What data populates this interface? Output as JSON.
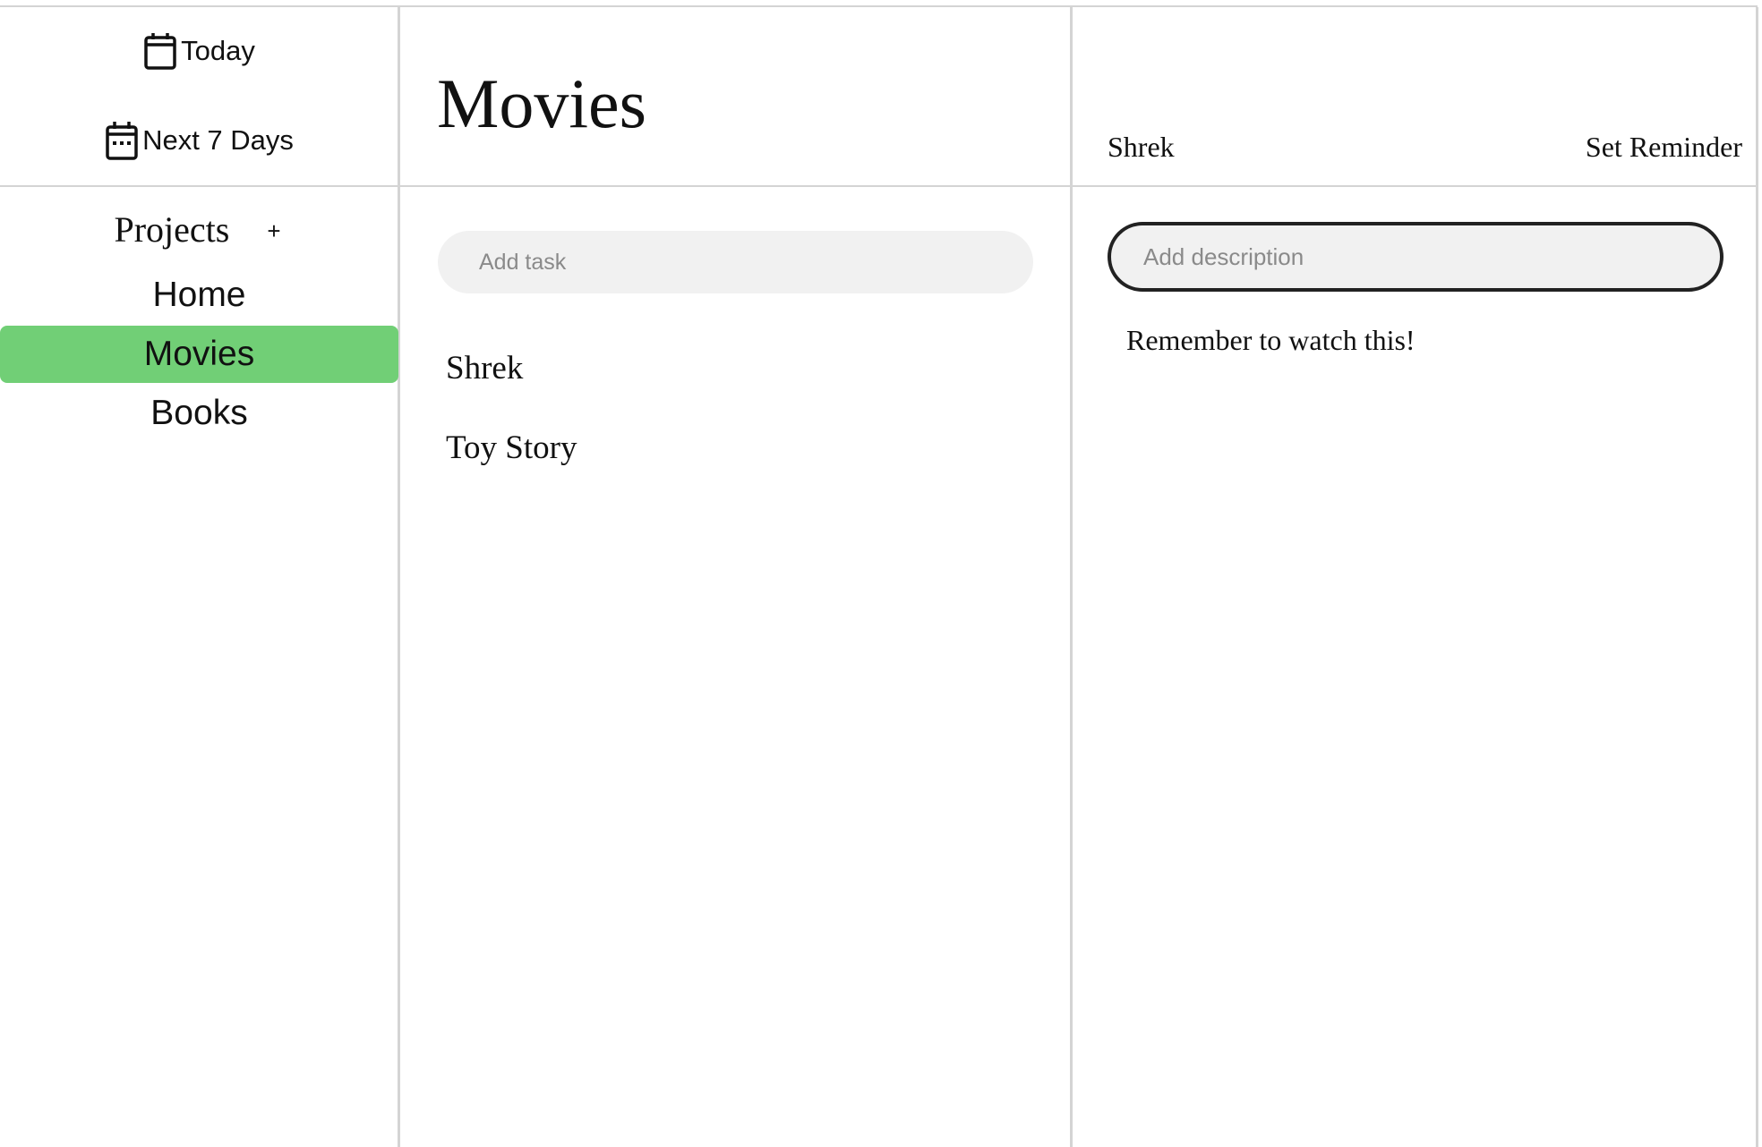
{
  "sidebar": {
    "today": {
      "label": "Today",
      "icon": "calendar-icon"
    },
    "next7": {
      "label": "Next 7 Days",
      "icon": "calendar-week-icon"
    },
    "projects": {
      "title": "Projects",
      "add_label": "+",
      "items": [
        {
          "label": "Home",
          "active": false
        },
        {
          "label": "Movies",
          "active": true
        },
        {
          "label": "Books",
          "active": false
        }
      ]
    },
    "active_color": "#71cf76"
  },
  "main": {
    "title": "Movies",
    "add_task": {
      "value": "",
      "placeholder": "Add task"
    },
    "tasks": [
      {
        "label": "Shrek"
      },
      {
        "label": "Toy Story"
      }
    ]
  },
  "detail": {
    "title": "Shrek",
    "reminder_label": "Set Reminder",
    "description_input": {
      "value": "",
      "placeholder": "Add description"
    },
    "description": "Remember to watch this!"
  }
}
